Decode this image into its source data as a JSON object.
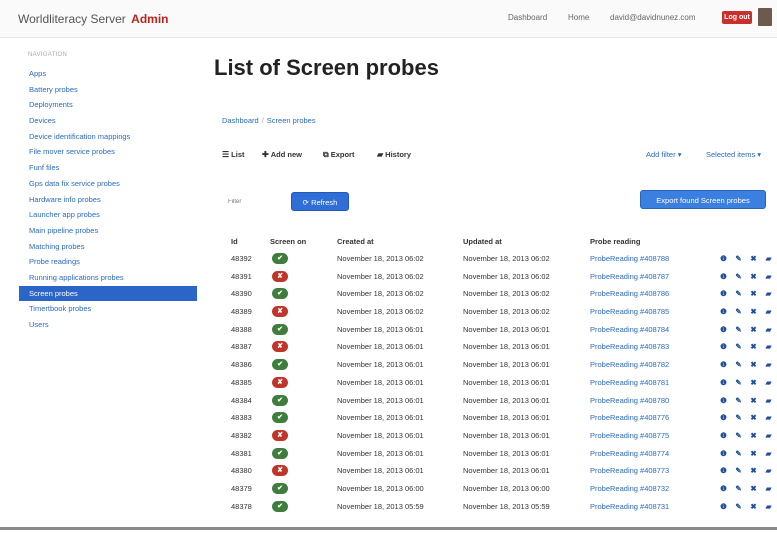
{
  "brand": {
    "name": "Worldliteracy Server",
    "admin": "Admin"
  },
  "topnav": {
    "dashboard": "Dashboard",
    "home": "Home",
    "email": "david@davidnunez.com",
    "logout": "Log out"
  },
  "sidebar": {
    "header": "NAVIGATION",
    "items": [
      {
        "label": "Apps"
      },
      {
        "label": "Battery probes"
      },
      {
        "label": "Deployments"
      },
      {
        "label": "Devices"
      },
      {
        "label": "Device identification mappings"
      },
      {
        "label": "File mover service probes"
      },
      {
        "label": "Funf files"
      },
      {
        "label": "Gps data fix service probes"
      },
      {
        "label": "Hardware info probes"
      },
      {
        "label": "Launcher app probes"
      },
      {
        "label": "Main pipeline probes"
      },
      {
        "label": "Matching probes"
      },
      {
        "label": "Probe readings"
      },
      {
        "label": "Running applications probes"
      },
      {
        "label": "Screen probes"
      },
      {
        "label": "Timertbook probes"
      },
      {
        "label": "Users"
      }
    ],
    "active_index": 14
  },
  "page": {
    "title": "List of Screen probes",
    "breadcrumb": [
      "Dashboard",
      "Screen probes"
    ]
  },
  "actions": {
    "list": "List",
    "add_new": "Add new",
    "export": "Export",
    "history": "History"
  },
  "right_actions": {
    "add_filter": "Add filter",
    "selected_items": "Selected items"
  },
  "filter": {
    "placeholder": "Filter"
  },
  "buttons": {
    "refresh": "Refresh",
    "export_found": "Export found Screen probes"
  },
  "table": {
    "headers": {
      "id": "Id",
      "screen_on": "Screen on",
      "created_at": "Created at",
      "updated_at": "Updated at",
      "probe_reading": "Probe reading"
    },
    "rows": [
      {
        "id": "48392",
        "screen_on": true,
        "created": "November 18, 2013 06:02",
        "updated": "November 18, 2013 06:02",
        "probe": "ProbeReading #408788"
      },
      {
        "id": "48391",
        "screen_on": false,
        "created": "November 18, 2013 06:02",
        "updated": "November 18, 2013 06:02",
        "probe": "ProbeReading #408787"
      },
      {
        "id": "48390",
        "screen_on": true,
        "created": "November 18, 2013 06:02",
        "updated": "November 18, 2013 06:02",
        "probe": "ProbeReading #408786"
      },
      {
        "id": "48389",
        "screen_on": false,
        "created": "November 18, 2013 06:02",
        "updated": "November 18, 2013 06:02",
        "probe": "ProbeReading #408785"
      },
      {
        "id": "48388",
        "screen_on": true,
        "created": "November 18, 2013 06:01",
        "updated": "November 18, 2013 06:01",
        "probe": "ProbeReading #408784"
      },
      {
        "id": "48387",
        "screen_on": false,
        "created": "November 18, 2013 06:01",
        "updated": "November 18, 2013 06:01",
        "probe": "ProbeReading #408783"
      },
      {
        "id": "48386",
        "screen_on": true,
        "created": "November 18, 2013 06:01",
        "updated": "November 18, 2013 06:01",
        "probe": "ProbeReading #408782"
      },
      {
        "id": "48385",
        "screen_on": false,
        "created": "November 18, 2013 06:01",
        "updated": "November 18, 2013 06:01",
        "probe": "ProbeReading #408781"
      },
      {
        "id": "48384",
        "screen_on": true,
        "created": "November 18, 2013 06:01",
        "updated": "November 18, 2013 06:01",
        "probe": "ProbeReading #408780"
      },
      {
        "id": "48383",
        "screen_on": true,
        "created": "November 18, 2013 06:01",
        "updated": "November 18, 2013 06:01",
        "probe": "ProbeReading #408776"
      },
      {
        "id": "48382",
        "screen_on": false,
        "created": "November 18, 2013 06:01",
        "updated": "November 18, 2013 06:01",
        "probe": "ProbeReading #408775"
      },
      {
        "id": "48381",
        "screen_on": true,
        "created": "November 18, 2013 06:01",
        "updated": "November 18, 2013 06:01",
        "probe": "ProbeReading #408774"
      },
      {
        "id": "48380",
        "screen_on": false,
        "created": "November 18, 2013 06:01",
        "updated": "November 18, 2013 06:01",
        "probe": "ProbeReading #408773"
      },
      {
        "id": "48379",
        "screen_on": true,
        "created": "November 18, 2013 06:00",
        "updated": "November 18, 2013 06:00",
        "probe": "ProbeReading #408732"
      },
      {
        "id": "48378",
        "screen_on": true,
        "created": "November 18, 2013 05:59",
        "updated": "November 18, 2013 05:59",
        "probe": "ProbeReading #408731"
      }
    ],
    "row_action_icons": [
      "info-icon",
      "edit-icon",
      "delete-icon",
      "history-icon"
    ]
  },
  "colors": {
    "brand_red": "#b9251c",
    "link_blue": "#2a6bbf",
    "active_blue": "#2a65c7",
    "on_green": "#3f7d3c",
    "off_red": "#c0352a",
    "button_blue": "#2f6ed6"
  }
}
